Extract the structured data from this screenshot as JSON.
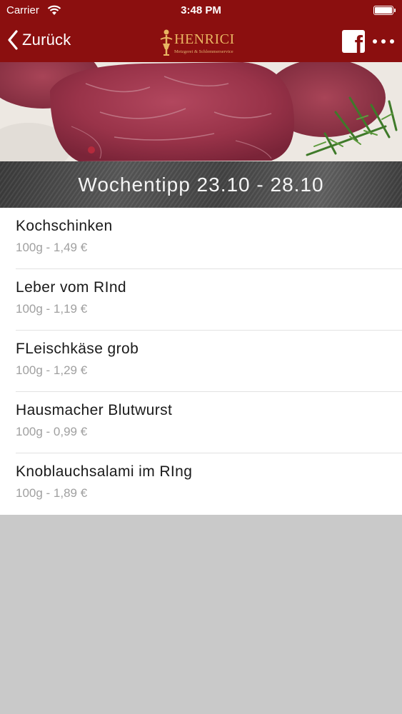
{
  "status_bar": {
    "carrier": "Carrier",
    "time": "3:48 PM"
  },
  "nav": {
    "back_label": "Zurück",
    "logo_title": "HENRICI",
    "logo_subtitle": "Metzgerei & Schlemmerservice",
    "brand_color": "#8b0f0f",
    "logo_color": "#e8b562"
  },
  "banner": {
    "title": "Wochentipp 23.10 - 28.10"
  },
  "items": [
    {
      "name": "Kochschinken",
      "price": "100g - 1,49 €"
    },
    {
      "name": "Leber vom RInd",
      "price": "100g - 1,19 €"
    },
    {
      "name": "FLeischkäse grob",
      "price": "100g - 1,29 €"
    },
    {
      "name": "Hausmacher Blutwurst",
      "price": "100g - 0,99 €"
    },
    {
      "name": "Knoblauchsalami im RIng",
      "price": "100g - 1,89 €"
    }
  ],
  "icons": [
    "wifi-icon",
    "battery-icon",
    "back-chevron-icon",
    "logo-figure-icon",
    "facebook-icon",
    "more-icon"
  ]
}
